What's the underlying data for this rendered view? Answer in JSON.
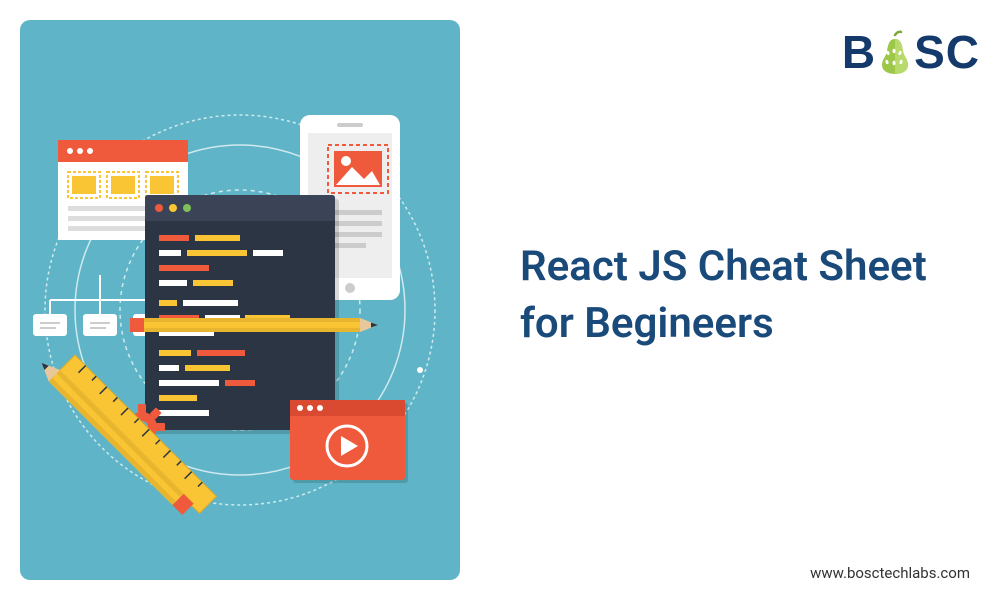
{
  "logo": {
    "letters_left": "B",
    "letters_right": "SC",
    "icon_name": "pear-icon"
  },
  "title": "React JS Cheat Sheet for Begineers",
  "url": "www.bosctechlabs.com",
  "colors": {
    "panel_bg": "#5fb5c7",
    "title_color": "#1a4a7a",
    "logo_color": "#133a6b",
    "pear_green": "#9cc749",
    "pear_dark": "#7da836",
    "orange": "#f05a3c",
    "yellow": "#f9c534",
    "dark_navy": "#2c3544",
    "white": "#ffffff",
    "gray": "#888888"
  },
  "illustration": {
    "description": "Flat design illustration of coding tools: code editor window, smartphone, browser wireframe, ruler, pencil, gear, play button, on circular orbit lines",
    "elements": [
      "code-window",
      "phone",
      "browser-card",
      "ruler",
      "pencil",
      "gear",
      "video-play-card",
      "orbit-circles",
      "node-boxes"
    ]
  }
}
